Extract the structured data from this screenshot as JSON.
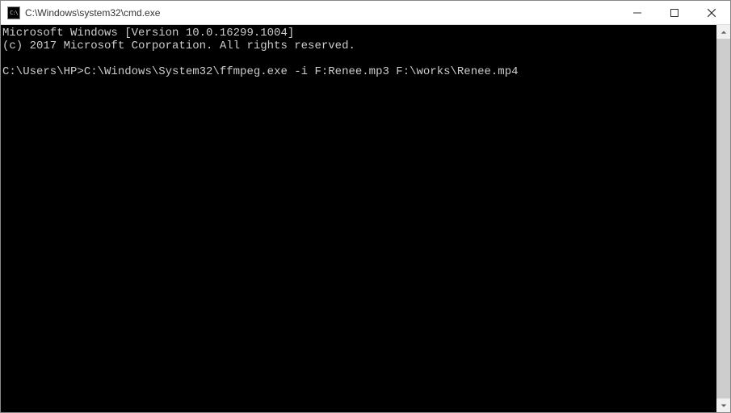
{
  "window": {
    "title": "C:\\Windows\\system32\\cmd.exe"
  },
  "terminal": {
    "line1": "Microsoft Windows [Version 10.0.16299.1004]",
    "line2": "(c) 2017 Microsoft Corporation. All rights reserved.",
    "blank": "",
    "prompt": "C:\\Users\\HP>",
    "command": "C:\\Windows\\System32\\ffmpeg.exe -i F:Renee.mp3 F:\\works\\Renee.mp4"
  },
  "icon_text": "C:\\"
}
